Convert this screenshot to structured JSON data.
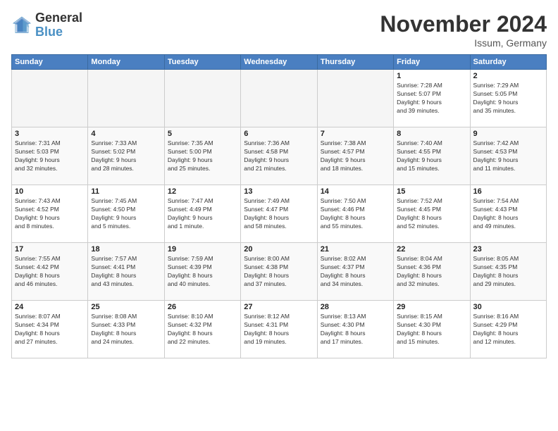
{
  "logo": {
    "general": "General",
    "blue": "Blue"
  },
  "header": {
    "month": "November 2024",
    "location": "Issum, Germany"
  },
  "weekdays": [
    "Sunday",
    "Monday",
    "Tuesday",
    "Wednesday",
    "Thursday",
    "Friday",
    "Saturday"
  ],
  "weeks": [
    [
      {
        "day": "",
        "info": ""
      },
      {
        "day": "",
        "info": ""
      },
      {
        "day": "",
        "info": ""
      },
      {
        "day": "",
        "info": ""
      },
      {
        "day": "",
        "info": ""
      },
      {
        "day": "1",
        "info": "Sunrise: 7:28 AM\nSunset: 5:07 PM\nDaylight: 9 hours\nand 39 minutes."
      },
      {
        "day": "2",
        "info": "Sunrise: 7:29 AM\nSunset: 5:05 PM\nDaylight: 9 hours\nand 35 minutes."
      }
    ],
    [
      {
        "day": "3",
        "info": "Sunrise: 7:31 AM\nSunset: 5:03 PM\nDaylight: 9 hours\nand 32 minutes."
      },
      {
        "day": "4",
        "info": "Sunrise: 7:33 AM\nSunset: 5:02 PM\nDaylight: 9 hours\nand 28 minutes."
      },
      {
        "day": "5",
        "info": "Sunrise: 7:35 AM\nSunset: 5:00 PM\nDaylight: 9 hours\nand 25 minutes."
      },
      {
        "day": "6",
        "info": "Sunrise: 7:36 AM\nSunset: 4:58 PM\nDaylight: 9 hours\nand 21 minutes."
      },
      {
        "day": "7",
        "info": "Sunrise: 7:38 AM\nSunset: 4:57 PM\nDaylight: 9 hours\nand 18 minutes."
      },
      {
        "day": "8",
        "info": "Sunrise: 7:40 AM\nSunset: 4:55 PM\nDaylight: 9 hours\nand 15 minutes."
      },
      {
        "day": "9",
        "info": "Sunrise: 7:42 AM\nSunset: 4:53 PM\nDaylight: 9 hours\nand 11 minutes."
      }
    ],
    [
      {
        "day": "10",
        "info": "Sunrise: 7:43 AM\nSunset: 4:52 PM\nDaylight: 9 hours\nand 8 minutes."
      },
      {
        "day": "11",
        "info": "Sunrise: 7:45 AM\nSunset: 4:50 PM\nDaylight: 9 hours\nand 5 minutes."
      },
      {
        "day": "12",
        "info": "Sunrise: 7:47 AM\nSunset: 4:49 PM\nDaylight: 9 hours\nand 1 minute."
      },
      {
        "day": "13",
        "info": "Sunrise: 7:49 AM\nSunset: 4:47 PM\nDaylight: 8 hours\nand 58 minutes."
      },
      {
        "day": "14",
        "info": "Sunrise: 7:50 AM\nSunset: 4:46 PM\nDaylight: 8 hours\nand 55 minutes."
      },
      {
        "day": "15",
        "info": "Sunrise: 7:52 AM\nSunset: 4:45 PM\nDaylight: 8 hours\nand 52 minutes."
      },
      {
        "day": "16",
        "info": "Sunrise: 7:54 AM\nSunset: 4:43 PM\nDaylight: 8 hours\nand 49 minutes."
      }
    ],
    [
      {
        "day": "17",
        "info": "Sunrise: 7:55 AM\nSunset: 4:42 PM\nDaylight: 8 hours\nand 46 minutes."
      },
      {
        "day": "18",
        "info": "Sunrise: 7:57 AM\nSunset: 4:41 PM\nDaylight: 8 hours\nand 43 minutes."
      },
      {
        "day": "19",
        "info": "Sunrise: 7:59 AM\nSunset: 4:39 PM\nDaylight: 8 hours\nand 40 minutes."
      },
      {
        "day": "20",
        "info": "Sunrise: 8:00 AM\nSunset: 4:38 PM\nDaylight: 8 hours\nand 37 minutes."
      },
      {
        "day": "21",
        "info": "Sunrise: 8:02 AM\nSunset: 4:37 PM\nDaylight: 8 hours\nand 34 minutes."
      },
      {
        "day": "22",
        "info": "Sunrise: 8:04 AM\nSunset: 4:36 PM\nDaylight: 8 hours\nand 32 minutes."
      },
      {
        "day": "23",
        "info": "Sunrise: 8:05 AM\nSunset: 4:35 PM\nDaylight: 8 hours\nand 29 minutes."
      }
    ],
    [
      {
        "day": "24",
        "info": "Sunrise: 8:07 AM\nSunset: 4:34 PM\nDaylight: 8 hours\nand 27 minutes."
      },
      {
        "day": "25",
        "info": "Sunrise: 8:08 AM\nSunset: 4:33 PM\nDaylight: 8 hours\nand 24 minutes."
      },
      {
        "day": "26",
        "info": "Sunrise: 8:10 AM\nSunset: 4:32 PM\nDaylight: 8 hours\nand 22 minutes."
      },
      {
        "day": "27",
        "info": "Sunrise: 8:12 AM\nSunset: 4:31 PM\nDaylight: 8 hours\nand 19 minutes."
      },
      {
        "day": "28",
        "info": "Sunrise: 8:13 AM\nSunset: 4:30 PM\nDaylight: 8 hours\nand 17 minutes."
      },
      {
        "day": "29",
        "info": "Sunrise: 8:15 AM\nSunset: 4:30 PM\nDaylight: 8 hours\nand 15 minutes."
      },
      {
        "day": "30",
        "info": "Sunrise: 8:16 AM\nSunset: 4:29 PM\nDaylight: 8 hours\nand 12 minutes."
      }
    ]
  ]
}
